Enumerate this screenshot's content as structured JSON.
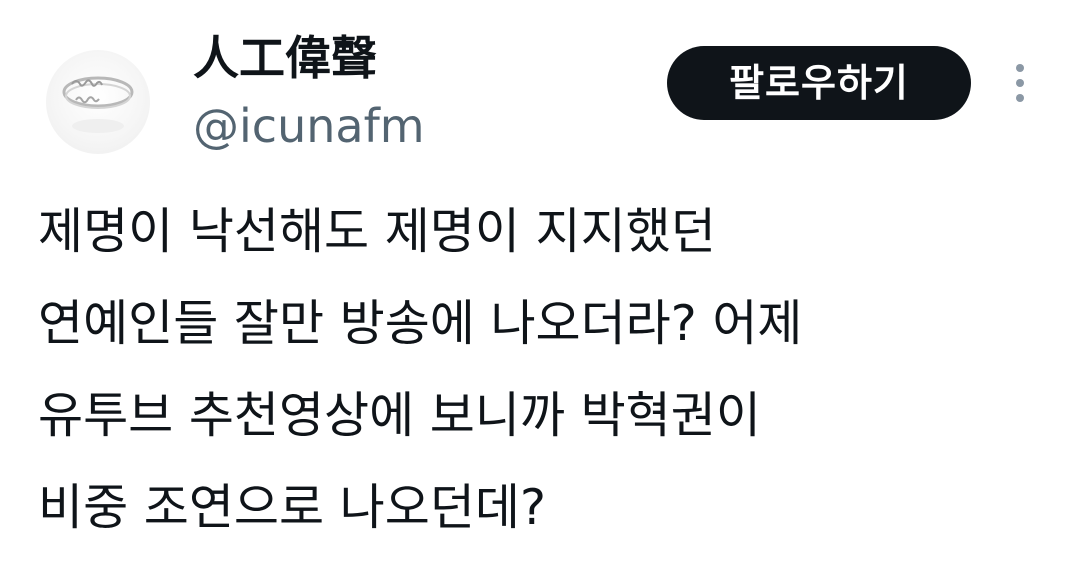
{
  "author": {
    "display_name": "人工偉聲",
    "handle": "@icunafm",
    "avatar_icon": "ring-photo-avatar"
  },
  "actions": {
    "follow_label": "팔로우하기",
    "more_icon": "more-vertical-icon"
  },
  "tweet": {
    "lines": [
      "제명이 낙선해도 제명이 지지했던",
      "연예인들 잘만 방송에 나오더라? 어제",
      "유투브 추천영상에 보니까 박혁권이",
      "비중 조연으로 나오던데?"
    ]
  },
  "colors": {
    "text_primary": "#0f1419",
    "text_secondary": "#536471",
    "button_bg": "#0f1419",
    "button_text": "#ffffff",
    "icon_gray": "#8b98a5"
  }
}
